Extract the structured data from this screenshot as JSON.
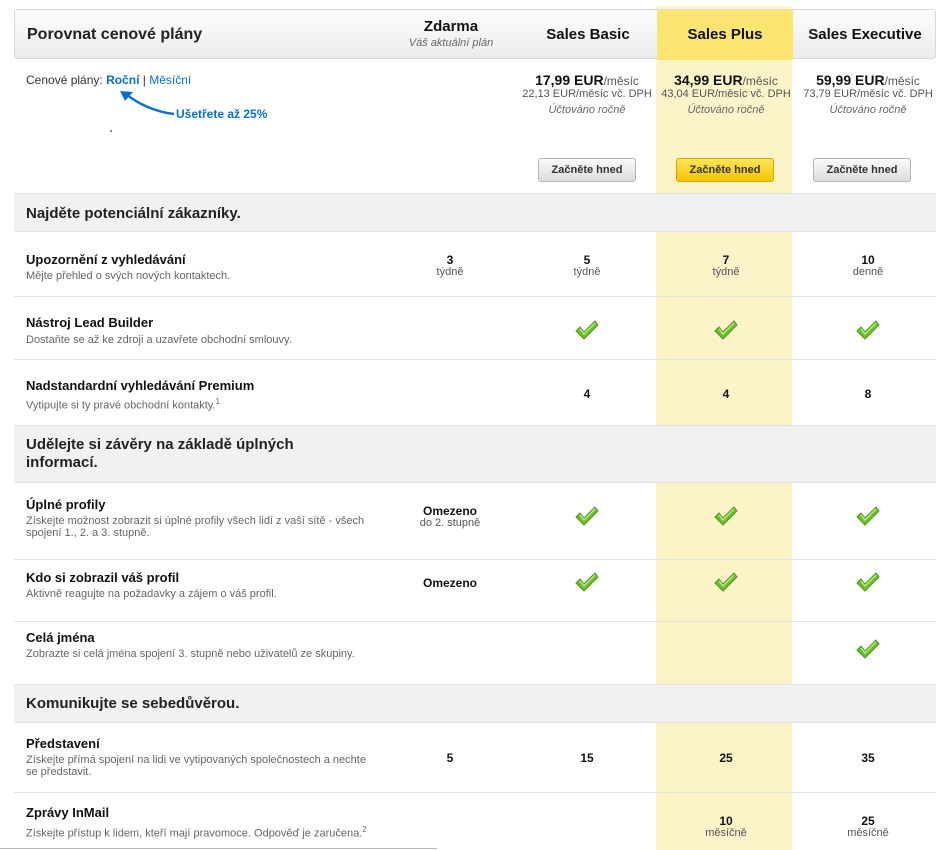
{
  "header": {
    "title": "Porovnat cenové plány",
    "plans": [
      {
        "name": "Zdarma",
        "sub": "Váš aktuální plán"
      },
      {
        "name": "Sales Basic"
      },
      {
        "name": "Sales Plus"
      },
      {
        "name": "Sales Executive"
      }
    ]
  },
  "pricing": {
    "label": "Cenové plány:",
    "annual": "Roční",
    "separator": "|",
    "monthly": "Měsíční",
    "save_note": "Ušetřete až 25%",
    "plans": [
      {
        "price": "17,99 EUR",
        "per": "/měsíc",
        "vat": "22,13 EUR/měsíc vč. DPH",
        "billed": "Účtováno ročně",
        "button": "Začněte hned"
      },
      {
        "price": "34,99 EUR",
        "per": "/měsíc",
        "vat": "43,04 EUR/měsíc vč. DPH",
        "billed": "Účtováno ročně",
        "button": "Začněte hned"
      },
      {
        "price": "59,99 EUR",
        "per": "/měsíc",
        "vat": "73,79 EUR/měsíc vč. DPH",
        "billed": "Účtováno ročně",
        "button": "Začněte hned"
      }
    ]
  },
  "sections": [
    {
      "title": "Najděte potenciální zákazníky."
    },
    {
      "title": "Udělejte si závěry na základě úplných informací."
    },
    {
      "title": "Komunikujte se sebedůvěrou."
    }
  ],
  "features": [
    {
      "title": "Upozornění z vyhledávání",
      "desc": "Mějte přehled o svých nových kontaktech.",
      "free": {
        "v": "3",
        "u": "týdně"
      },
      "basic": {
        "v": "5",
        "u": "týdně"
      },
      "plus": {
        "v": "7",
        "u": "týdně"
      },
      "exec": {
        "v": "10",
        "u": "denně"
      }
    },
    {
      "title": "Nástroj Lead Builder",
      "desc": "Dostaňte se až ke zdroji a uzavřete obchodní smlouvy.",
      "checks": [
        "basic",
        "plus",
        "exec"
      ]
    },
    {
      "title": "Nadstandardní vyhledávání Premium",
      "desc": "Vytipujte si ty pravé obchodní kontakty.",
      "footnote": "1",
      "basic": {
        "v": "4"
      },
      "plus": {
        "v": "4"
      },
      "exec": {
        "v": "8"
      }
    },
    {
      "title": "Úplné profily",
      "desc": "Získejte možnost zobrazit si úplné profily všech lidí z vaší sítě - všech spojení 1., 2. a 3. stupně.",
      "free": {
        "v": "Omezeno",
        "u": "do 2. stupně"
      },
      "checks": [
        "basic",
        "plus",
        "exec"
      ]
    },
    {
      "title": "Kdo si zobrazil váš profil",
      "desc": "Aktivně reagujte na požadavky a zájem o váš profil.",
      "free": {
        "v": "Omezeno"
      },
      "checks": [
        "basic",
        "plus",
        "exec"
      ]
    },
    {
      "title": "Celá jména",
      "desc": "Zobrazte si celá jména spojení 3. stupně nebo uživatelů ze skupiny.",
      "checks": [
        "exec"
      ]
    },
    {
      "title": "Představení",
      "desc": "Získejte přímá spojení na lidi ve vytipovaných společnostech a nechte se představit.",
      "free": {
        "v": "5"
      },
      "basic": {
        "v": "15"
      },
      "plus": {
        "v": "25"
      },
      "exec": {
        "v": "35"
      }
    },
    {
      "title": "Zprávy InMail",
      "desc": "Získejte přístup k lidem, kteří mají pravomoce. Odpověď je zaručena.",
      "footnote": "2",
      "plus": {
        "v": "10",
        "u": "měsíčně"
      },
      "exec": {
        "v": "25",
        "u": "měsíčně"
      }
    }
  ],
  "colors": {
    "accent_link": "#0b6fc5",
    "plus_highlight": "#fbe471",
    "check_green": "#6cbf2a"
  }
}
